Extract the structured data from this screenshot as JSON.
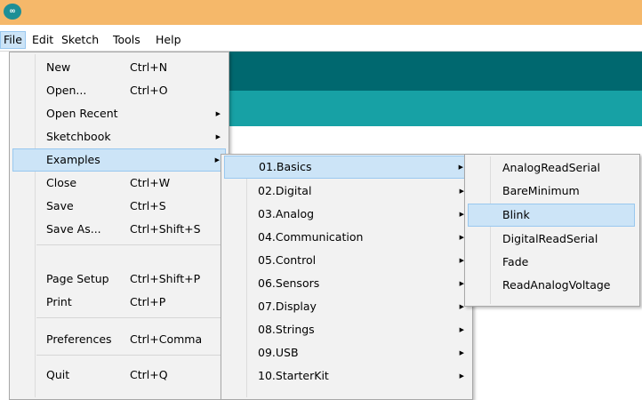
{
  "window": {
    "logo": "∞"
  },
  "menubar": {
    "items": [
      "File",
      "Edit",
      "Sketch",
      "Tools",
      "Help"
    ]
  },
  "file_menu": {
    "items": [
      {
        "label": "New",
        "shortcut": "Ctrl+N"
      },
      {
        "label": "Open...",
        "shortcut": "Ctrl+O"
      },
      {
        "label": "Open Recent",
        "shortcut": "",
        "submenu": true
      },
      {
        "label": "Sketchbook",
        "shortcut": "",
        "submenu": true
      },
      {
        "label": "Examples",
        "shortcut": "",
        "submenu": true,
        "highlighted": true
      },
      {
        "label": "Close",
        "shortcut": "Ctrl+W"
      },
      {
        "label": "Save",
        "shortcut": "Ctrl+S"
      },
      {
        "label": "Save As...",
        "shortcut": "Ctrl+Shift+S"
      },
      {
        "label": "Page Setup",
        "shortcut": "Ctrl+Shift+P"
      },
      {
        "label": "Print",
        "shortcut": "Ctrl+P"
      },
      {
        "label": "Preferences",
        "shortcut": "Ctrl+Comma"
      },
      {
        "label": "Quit",
        "shortcut": "Ctrl+Q"
      }
    ]
  },
  "examples_menu": {
    "items": [
      {
        "label": "01.Basics",
        "highlighted": true
      },
      {
        "label": "02.Digital"
      },
      {
        "label": "03.Analog"
      },
      {
        "label": "04.Communication"
      },
      {
        "label": "05.Control"
      },
      {
        "label": "06.Sensors"
      },
      {
        "label": "07.Display"
      },
      {
        "label": "08.Strings"
      },
      {
        "label": "09.USB"
      },
      {
        "label": "10.StarterKit"
      }
    ]
  },
  "basics_menu": {
    "items": [
      {
        "label": "AnalogReadSerial"
      },
      {
        "label": "BareMinimum"
      },
      {
        "label": "Blink",
        "highlighted": true
      },
      {
        "label": "DigitalReadSerial"
      },
      {
        "label": "Fade"
      },
      {
        "label": "ReadAnalogVoltage"
      }
    ]
  },
  "colors": {
    "titlebar": "#f5b86a",
    "toolbar_dark": "#00686f",
    "toolbar_teal": "#17a1a5",
    "menu_bg": "#f2f2f2",
    "highlight": "#cce4f7"
  }
}
